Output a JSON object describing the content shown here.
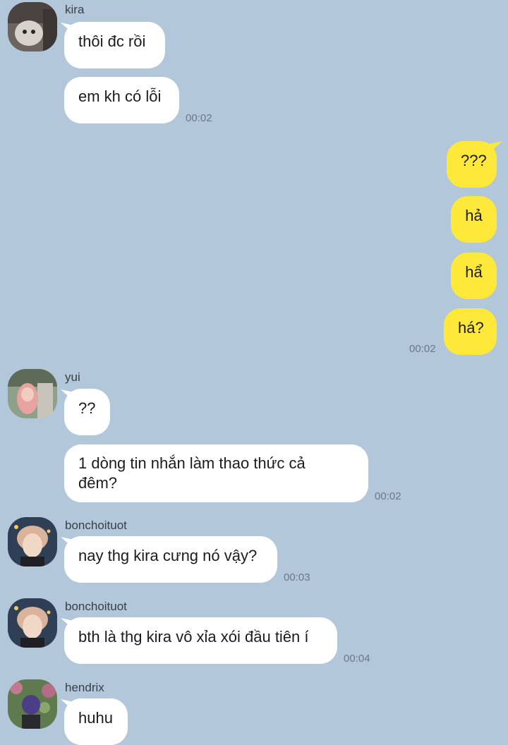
{
  "colors": {
    "background": "#b2c7da",
    "incoming_bubble": "#ffffff",
    "outgoing_bubble": "#fee83a",
    "timestamp": "#6b7885"
  },
  "groups": [
    {
      "sender": "kira",
      "messages": [
        "thôi đc rồi",
        "em kh có lỗi"
      ],
      "time": "00:02"
    },
    {
      "sender": "me",
      "messages": [
        "???",
        "hả",
        "hẩ",
        "há?"
      ],
      "time": "00:02"
    },
    {
      "sender": "yui",
      "messages": [
        "??",
        "1 dòng tin nhắn làm thao thức cả\nđêm?"
      ],
      "time": "00:02"
    },
    {
      "sender": "bonchoituot",
      "messages": [
        "nay thg kira cưng nó vậy?"
      ],
      "time": "00:03"
    },
    {
      "sender": "bonchoituot",
      "messages": [
        "bth là thg kira vô xỉa xói đầu tiên í"
      ],
      "time": "00:04"
    },
    {
      "sender": "hendrix",
      "messages": [
        "huhu"
      ]
    }
  ],
  "avatars": [
    "kira-avatar",
    "yui-avatar",
    "bonchoituot-avatar",
    "bonchoituot-avatar",
    "hendrix-avatar"
  ]
}
